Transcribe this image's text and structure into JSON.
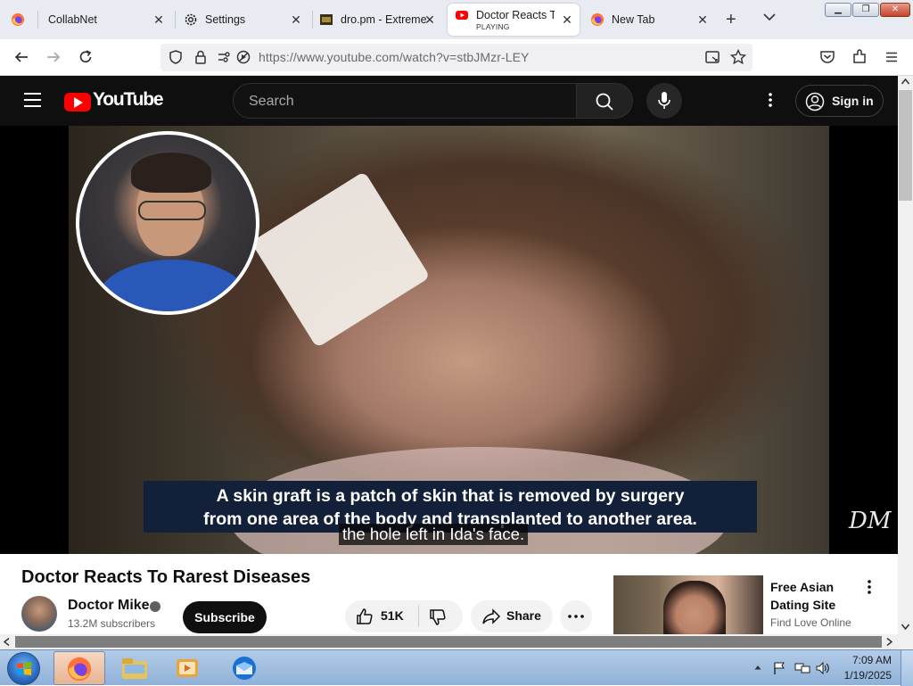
{
  "tabs": [
    {
      "title": "",
      "icon": "firefox-icon"
    },
    {
      "title": "CollabNet",
      "icon": "none"
    },
    {
      "title": "Settings",
      "icon": "gear-icon"
    },
    {
      "title": "dro.pm - Extreme",
      "icon": "dro-icon"
    },
    {
      "title": "Doctor Reacts To",
      "status": "PLAYING",
      "icon": "youtube-icon",
      "active": true
    },
    {
      "title": "New Tab",
      "icon": "firefox-icon"
    }
  ],
  "toolbar": {
    "url": "https://www.youtube.com/watch?v=stbJMzr-LEY"
  },
  "youtube": {
    "logo_text": "YouTube",
    "search_placeholder": "Search",
    "sign_in_label": "Sign in"
  },
  "video": {
    "caption_line1": "A skin graft is a patch of skin that is removed by surgery",
    "caption_line2": "from one area of the body and transplanted to another area.",
    "subtitle": "the hole left in Ida's face.",
    "signature": "DM"
  },
  "details": {
    "title": "Doctor Reacts To Rarest Diseases",
    "channel_name": "Doctor Mike",
    "subscribers": "13.2M subscribers",
    "subscribe_label": "Subscribe",
    "likes": "51K",
    "share_label": "Share"
  },
  "ad": {
    "title": "Free Asian Dating Site",
    "subtitle": "Find Love Online"
  },
  "taskbar": {
    "time": "7:09 AM",
    "date": "1/19/2025"
  },
  "colors": {
    "youtube_red": "#ff0000",
    "youtube_dark": "#0f0f0f",
    "caption_box": "#13203a",
    "tab_strip": "#e8ecf2"
  }
}
